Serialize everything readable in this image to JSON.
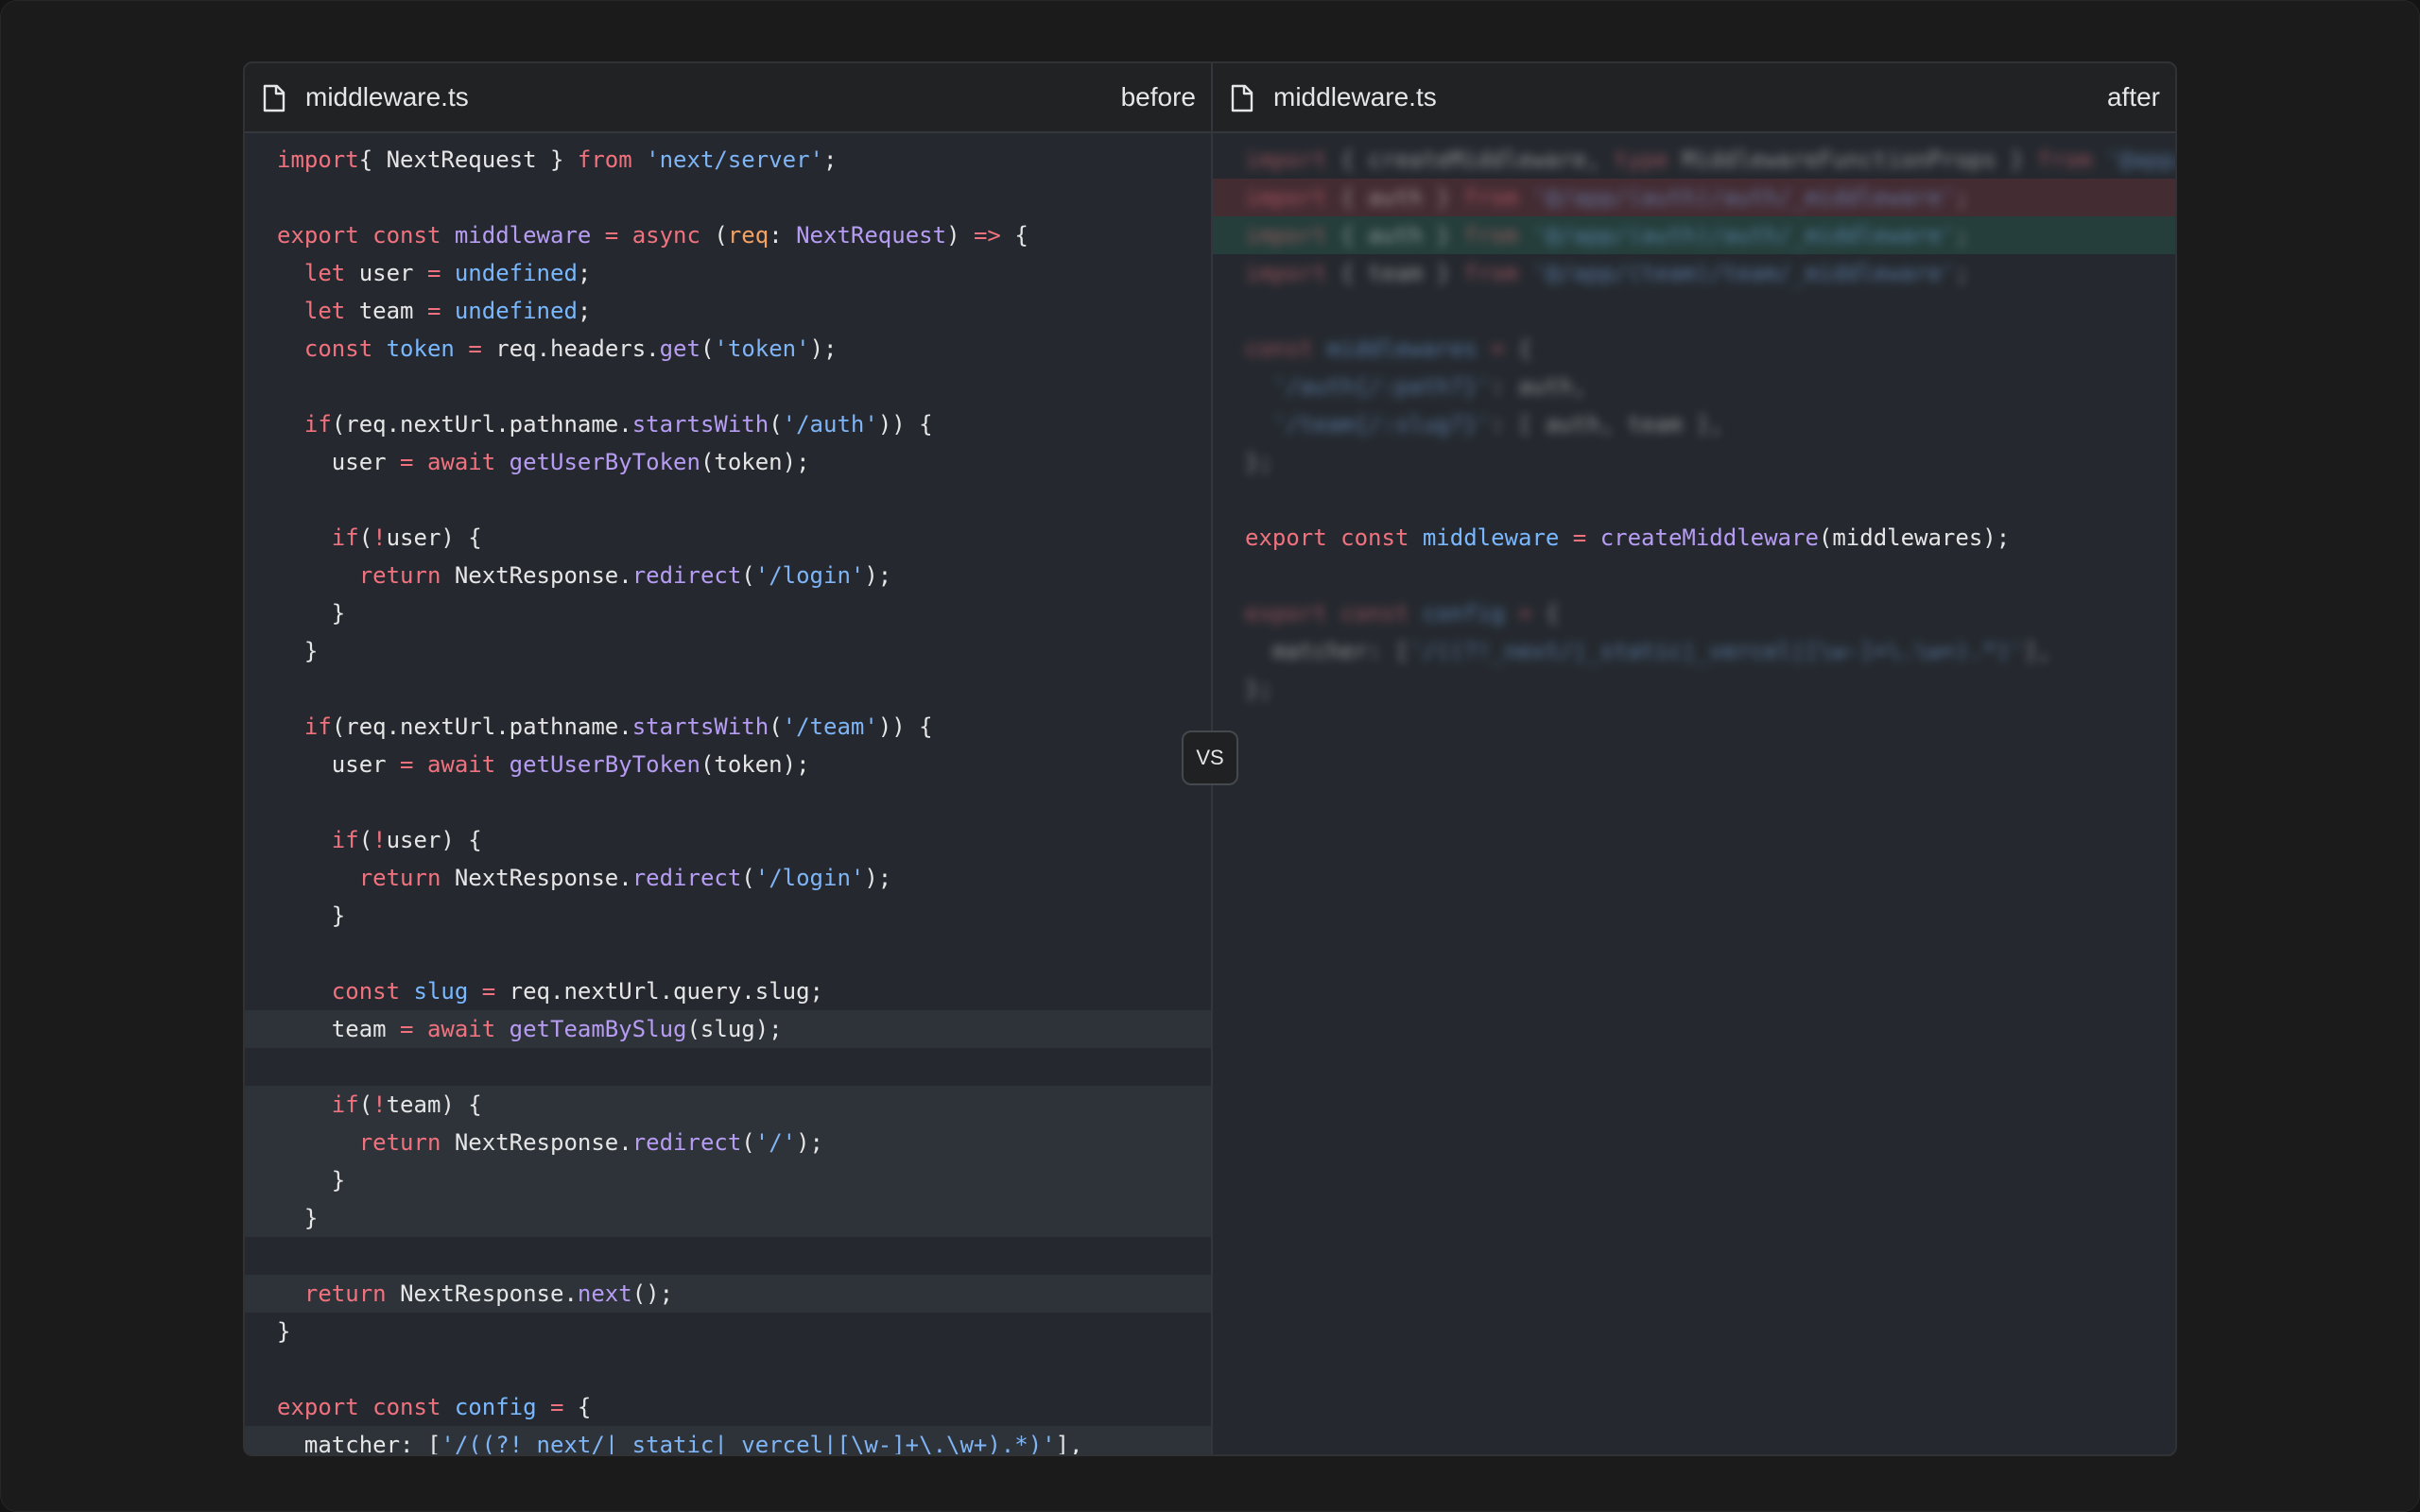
{
  "before": {
    "file_name": "middleware.ts",
    "label": "before"
  },
  "after": {
    "file_name": "middleware.ts",
    "label": "after"
  },
  "vs_label": "VS",
  "colors": {
    "keyword": "#f0727e",
    "function": "#b79cf3",
    "string": "#7fb4f5",
    "builtin": "#79b8ff",
    "param": "#f5a263",
    "text": "#e6e6e6",
    "background": "#25292f",
    "header": "#202224"
  },
  "before_code": [
    [
      [
        "import { NextRequest } ",
        "k0"
      ]
    ],
    [],
    [],
    [],
    [],
    [],
    [],
    [],
    [],
    [],
    [],
    [],
    [],
    [],
    [],
    [],
    [],
    [],
    [],
    [],
    [],
    [],
    [],
    [],
    [],
    [],
    [],
    [],
    [],
    [],
    [],
    [],
    [],
    [],
    []
  ],
  "left_lines": [
    {
      "row": 0,
      "hl": "",
      "tokens": [
        [
          "k",
          "import"
        ],
        [
          "",
          "{ NextRequest } "
        ],
        [
          "k",
          "from "
        ],
        [
          "s",
          "'next/server'"
        ],
        [
          "",
          ";"
        ]
      ]
    },
    {
      "row": 2,
      "hl": "",
      "tokens": [
        [
          "k",
          "export const "
        ],
        [
          "f",
          "middleware "
        ],
        [
          "k",
          "= async "
        ],
        [
          "",
          "("
        ],
        [
          "p",
          "req"
        ],
        [
          "",
          ": "
        ],
        [
          "f",
          "NextRequest"
        ],
        [
          "",
          ") "
        ],
        [
          "k",
          "=> "
        ],
        [
          "",
          "{"
        ]
      ]
    },
    {
      "row": 3,
      "hl": "",
      "tokens": [
        [
          "",
          "  "
        ],
        [
          "k",
          "let "
        ],
        [
          "",
          "user "
        ],
        [
          "k",
          "= "
        ],
        [
          "b",
          "undefined"
        ],
        [
          "",
          ";"
        ]
      ]
    },
    {
      "row": 4,
      "hl": "",
      "tokens": [
        [
          "",
          "  "
        ],
        [
          "k",
          "let "
        ],
        [
          "",
          "team "
        ],
        [
          "k",
          "= "
        ],
        [
          "b",
          "undefined"
        ],
        [
          "",
          ";"
        ]
      ]
    },
    {
      "row": 5,
      "hl": "",
      "tokens": [
        [
          "",
          "  "
        ],
        [
          "k",
          "const "
        ],
        [
          "b",
          "token "
        ],
        [
          "k",
          "= "
        ],
        [
          "",
          "req.headers."
        ],
        [
          "f",
          "get"
        ],
        [
          "",
          "("
        ],
        [
          "s",
          "'token'"
        ],
        [
          "",
          ");"
        ]
      ]
    },
    {
      "row": 7,
      "hl": "",
      "tokens": [
        [
          "",
          "  "
        ],
        [
          "k",
          "if"
        ],
        [
          "",
          "(req.nextUrl.pathname."
        ],
        [
          "f",
          "startsWith"
        ],
        [
          "",
          "("
        ],
        [
          "s",
          "'/auth'"
        ],
        [
          "",
          ")) {"
        ]
      ]
    },
    {
      "row": 8,
      "hl": "",
      "tokens": [
        [
          "",
          "    user "
        ],
        [
          "k",
          "= await "
        ],
        [
          "f",
          "getUserByToken"
        ],
        [
          "",
          "(token);"
        ]
      ]
    },
    {
      "row": 10,
      "hl": "",
      "tokens": [
        [
          "",
          "    "
        ],
        [
          "k",
          "if"
        ],
        [
          "",
          "("
        ],
        [
          "k",
          "!"
        ],
        [
          "",
          "user) {"
        ]
      ]
    },
    {
      "row": 11,
      "hl": "",
      "tokens": [
        [
          "",
          "      "
        ],
        [
          "k",
          "return "
        ],
        [
          "",
          "NextResponse."
        ],
        [
          "f",
          "redirect"
        ],
        [
          "",
          "("
        ],
        [
          "s",
          "'/login'"
        ],
        [
          "",
          ");"
        ]
      ]
    },
    {
      "row": 12,
      "hl": "",
      "tokens": [
        [
          "",
          "    }"
        ]
      ]
    },
    {
      "row": 13,
      "hl": "",
      "tokens": [
        [
          "",
          "  }"
        ]
      ]
    },
    {
      "row": 15,
      "hl": "",
      "tokens": [
        [
          "",
          "  "
        ],
        [
          "k",
          "if"
        ],
        [
          "",
          "(req.nextUrl.pathname."
        ],
        [
          "f",
          "startsWith"
        ],
        [
          "",
          "("
        ],
        [
          "s",
          "'/team'"
        ],
        [
          "",
          ")) {"
        ]
      ]
    },
    {
      "row": 16,
      "hl": "",
      "tokens": [
        [
          "",
          "    user "
        ],
        [
          "k",
          "= await "
        ],
        [
          "f",
          "getUserByToken"
        ],
        [
          "",
          "(token);"
        ]
      ]
    },
    {
      "row": 18,
      "hl": "",
      "tokens": [
        [
          "",
          "    "
        ],
        [
          "k",
          "if"
        ],
        [
          "",
          "("
        ],
        [
          "k",
          "!"
        ],
        [
          "",
          "user) {"
        ]
      ]
    },
    {
      "row": 19,
      "hl": "",
      "tokens": [
        [
          "",
          "      "
        ],
        [
          "k",
          "return "
        ],
        [
          "",
          "NextResponse."
        ],
        [
          "f",
          "redirect"
        ],
        [
          "",
          "("
        ],
        [
          "s",
          "'/login'"
        ],
        [
          "",
          ");"
        ]
      ]
    },
    {
      "row": 20,
      "hl": "",
      "tokens": [
        [
          "",
          "    }"
        ]
      ]
    },
    {
      "row": 22,
      "hl": "",
      "tokens": [
        [
          "",
          "    "
        ],
        [
          "k",
          "const "
        ],
        [
          "b",
          "slug "
        ],
        [
          "k",
          "= "
        ],
        [
          "",
          "req.nextUrl.query.slug;"
        ]
      ]
    },
    {
      "row": 23,
      "hl": "hl",
      "tokens": [
        [
          "",
          "    team "
        ],
        [
          "k",
          "= await "
        ],
        [
          "f",
          "getTeamBySlug"
        ],
        [
          "",
          "(slug);"
        ]
      ]
    },
    {
      "row": 24,
      "hl": "",
      "tokens": []
    },
    {
      "row": 25,
      "hl": "hl",
      "tokens": [
        [
          "",
          "    "
        ],
        [
          "k",
          "if"
        ],
        [
          "",
          "("
        ],
        [
          "k",
          "!"
        ],
        [
          "",
          "team) {"
        ]
      ]
    },
    {
      "row": 26,
      "hl": "hl",
      "tokens": [
        [
          "",
          "      "
        ],
        [
          "k",
          "return "
        ],
        [
          "",
          "NextResponse."
        ],
        [
          "f",
          "redirect"
        ],
        [
          "",
          "("
        ],
        [
          "s",
          "'/'"
        ],
        [
          "",
          ");"
        ]
      ]
    },
    {
      "row": 27,
      "hl": "hl",
      "tokens": [
        [
          "",
          "    }"
        ]
      ]
    },
    {
      "row": 28,
      "hl": "hl",
      "tokens": [
        [
          "",
          "  }"
        ]
      ]
    },
    {
      "row": 30,
      "hl": "hl",
      "tokens": [
        [
          "",
          "  "
        ],
        [
          "k",
          "return "
        ],
        [
          "",
          "NextResponse."
        ],
        [
          "f",
          "next"
        ],
        [
          "",
          "();"
        ]
      ]
    },
    {
      "row": 31,
      "hl": "",
      "tokens": [
        [
          "",
          "}"
        ]
      ]
    },
    {
      "row": 33,
      "hl": "",
      "tokens": [
        [
          "k",
          "export const "
        ],
        [
          "b",
          "config "
        ],
        [
          "k",
          "= "
        ],
        [
          "",
          "{"
        ]
      ]
    },
    {
      "row": 34,
      "hl": "hl",
      "tokens": [
        [
          "",
          "  matcher: ["
        ],
        [
          "s",
          "'/((?!_next/|_static|_vercel|[\\w-]+\\.\\w+).*)'"
        ],
        [
          "",
          "],"
        ]
      ]
    },
    {
      "row": 35,
      "hl": "",
      "tokens": [
        [
          "",
          "};"
        ]
      ]
    }
  ],
  "right_lines": [
    {
      "row": 0,
      "hl": "",
      "blur": true,
      "tokens": [
        [
          "k",
          "import "
        ],
        [
          "",
          "{ createMiddleware, "
        ],
        [
          "k",
          "type "
        ],
        [
          "",
          "MiddlewareFunctionProps } "
        ],
        [
          "k",
          "from "
        ],
        [
          "s",
          "'@app/middleware'"
        ]
      ]
    },
    {
      "row": 1,
      "hl": "del",
      "blur": true,
      "tokens": [
        [
          "k",
          "import "
        ],
        [
          "",
          "{ auth } "
        ],
        [
          "k",
          "from "
        ],
        [
          "s",
          "'@/app/(auth)/auth/_middleware'"
        ],
        [
          "",
          ";"
        ]
      ]
    },
    {
      "row": 2,
      "hl": "add",
      "blur": true,
      "tokens": [
        [
          "k",
          "import "
        ],
        [
          "",
          "{ auth } "
        ],
        [
          "k",
          "from "
        ],
        [
          "s",
          "'@/app/(auth)/auth/_middleware'"
        ],
        [
          "",
          ";"
        ]
      ]
    },
    {
      "row": 3,
      "hl": "",
      "blur": true,
      "tokens": [
        [
          "k",
          "import "
        ],
        [
          "",
          "{ team } "
        ],
        [
          "k",
          "from "
        ],
        [
          "s",
          "'@/app/(team)/team/_middleware'"
        ],
        [
          "",
          ";"
        ]
      ]
    },
    {
      "row": 5,
      "hl": "",
      "blur": true,
      "tokens": [
        [
          "k",
          "const "
        ],
        [
          "b",
          "middlewares "
        ],
        [
          "k",
          "= "
        ],
        [
          "",
          "{"
        ]
      ]
    },
    {
      "row": 6,
      "hl": "",
      "blur": true,
      "tokens": [
        [
          "",
          "  "
        ],
        [
          "s",
          "'/auth{/:path?}'"
        ],
        [
          "",
          ": auth,"
        ]
      ]
    },
    {
      "row": 7,
      "hl": "",
      "blur": true,
      "tokens": [
        [
          "",
          "  "
        ],
        [
          "s",
          "'/team{/:slug?}'"
        ],
        [
          "",
          ": [ auth, team ],"
        ]
      ]
    },
    {
      "row": 8,
      "hl": "",
      "blur": true,
      "tokens": [
        [
          "",
          "};"
        ]
      ]
    },
    {
      "row": 10,
      "hl": "",
      "blur": false,
      "tokens": [
        [
          "k",
          "export const "
        ],
        [
          "b",
          "middleware "
        ],
        [
          "k",
          "= "
        ],
        [
          "f",
          "createMiddleware"
        ],
        [
          "",
          "(middlewares);"
        ]
      ]
    },
    {
      "row": 12,
      "hl": "",
      "blur": true,
      "tokens": [
        [
          "k",
          "export const "
        ],
        [
          "b",
          "config "
        ],
        [
          "k",
          "= "
        ],
        [
          "",
          "{"
        ]
      ]
    },
    {
      "row": 13,
      "hl": "",
      "blur": true,
      "tokens": [
        [
          "",
          "  matcher: ["
        ],
        [
          "s",
          "'/((?!_next/|_static|_vercel|[\\w-]+\\.\\w+).*)'"
        ],
        [
          "",
          "],"
        ]
      ]
    },
    {
      "row": 14,
      "hl": "",
      "blur": true,
      "tokens": [
        [
          "",
          "};"
        ]
      ]
    }
  ]
}
